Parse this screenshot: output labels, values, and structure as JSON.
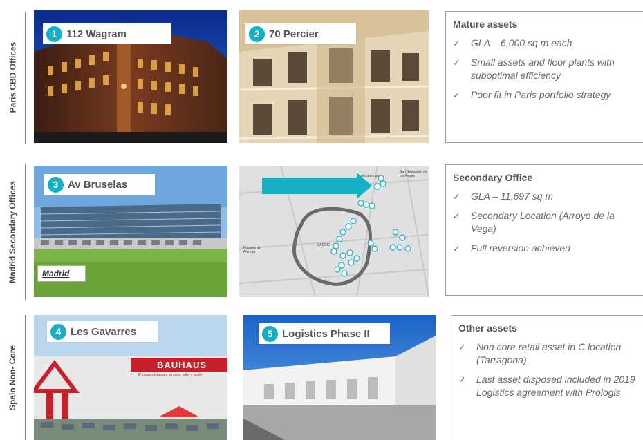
{
  "sections": [
    {
      "label": "Paris CBD Offices"
    },
    {
      "label": "Madrid Secondary Offices"
    },
    {
      "label": "Spain Non- Core"
    }
  ],
  "assets": [
    {
      "num": "1",
      "name": "112 Wagram"
    },
    {
      "num": "2",
      "name": "70 Percier"
    },
    {
      "num": "3",
      "name": "Av Bruselas"
    },
    {
      "num": "4",
      "name": "Les Gavarres"
    },
    {
      "num": "5",
      "name": "Logistics Phase II"
    }
  ],
  "madrid_caption": "Madrid",
  "bauhaus": {
    "brand": "BAUHAUS",
    "slogan": "El especialista para su casa, taller y jardín"
  },
  "map": {
    "labels": [
      "San Sebastián de los Reyes",
      "Alcobendas",
      "MADRID",
      "Pozuelo de Alarcón"
    ]
  },
  "panels": [
    {
      "title": "Mature assets",
      "items": [
        "GLA – 6,000 sq m each",
        "Small assets and floor plants with suboptimal efficiency",
        "Poor fit in Paris portfolio strategy"
      ]
    },
    {
      "title": "Secondary Office",
      "items": [
        "GLA – 11,697 sq m",
        "Secondary Location (Arroyo de la Vega)",
        "Full reversion achieved"
      ]
    },
    {
      "title": "Other assets",
      "items": [
        "Non core retail asset in C location (Tarragona)",
        "Last asset disposed included in 2019 Logistics agreement with Prologis"
      ]
    }
  ],
  "check_glyph": "✓",
  "colors": {
    "accent": "#16b0c6",
    "text": "#555555",
    "border": "#9a9a9a"
  }
}
